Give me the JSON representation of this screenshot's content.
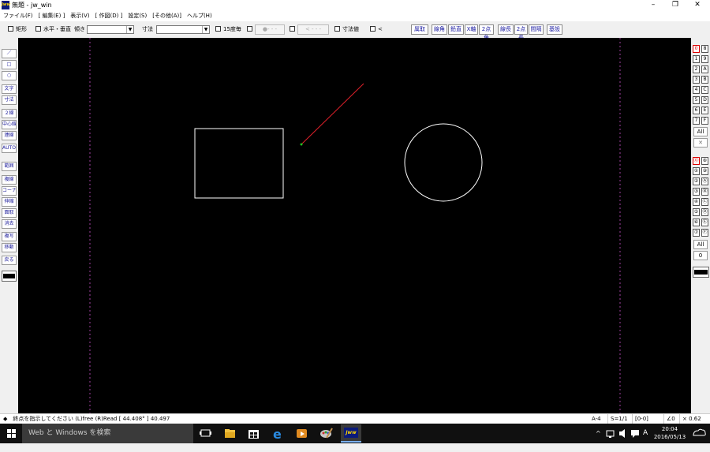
{
  "window": {
    "title": "無題 - jw_win",
    "app_icon_text": "Jww",
    "minimize_glyph": "–",
    "maximize_glyph": "❐",
    "close_glyph": "✕"
  },
  "menu": [
    "ファイル(F)",
    "[ 編集(E) ]",
    "表示(V)",
    "[ 作図(D) ]",
    "設定(S)",
    "[その他(A)]",
    "ヘルプ(H)"
  ],
  "toolbar": {
    "rect_label": "矩形",
    "hv_label": "水平・垂直",
    "slope_label": "傾き",
    "slope_value": "",
    "dim_label": "寸法",
    "dim_value": "",
    "deg15_label": "15度毎",
    "grey1_label": "●- - -",
    "grey2_label": "< - - -",
    "dimval_label": "寸法値",
    "lt_label": "<",
    "buttons": [
      "属取",
      "線角",
      "鉛直",
      "X軸",
      "2点角",
      "線長",
      "2点長",
      "間隔",
      "基設"
    ]
  },
  "left_tools": [
    "／",
    "□",
    "○",
    "文字",
    "寸法",
    "２線",
    "中心線",
    "連線",
    "AUTO",
    "範囲",
    "複線",
    "コーナー",
    "伸縮",
    "面取",
    "消去",
    "複写",
    "移動",
    "戻る"
  ],
  "layer_groups": {
    "rows_left": [
      "0",
      "1",
      "2",
      "3",
      "4",
      "5",
      "6",
      "7"
    ],
    "rows_right": [
      "8",
      "9",
      "A",
      "B",
      "C",
      "D",
      "E",
      "F"
    ],
    "all_label": "All",
    "x_label": "✕",
    "layers_left": [
      "⓪",
      "①",
      "②",
      "③",
      "④",
      "⑤",
      "⑥",
      "⑦"
    ],
    "layers_right": [
      "⑧",
      "⑨",
      "Ⓐ",
      "Ⓑ",
      "Ⓒ",
      "Ⓓ",
      "Ⓔ",
      "Ⓕ"
    ],
    "all2_label": "All",
    "zero_label": "0"
  },
  "status": {
    "message": "◆　終点を指示してください (L)free (R)Read [ 44.408° ] 40.497",
    "paper": "A-4",
    "scale": "S=1/1",
    "layer": "[0-0]",
    "angle": "∠0",
    "zoom": "× 0.62"
  },
  "taskbar": {
    "search_placeholder": "Web と Windows を検索",
    "ime": "A",
    "time": "20:04",
    "date": "2016/05/13"
  },
  "colors": {
    "canvas": "#000000",
    "line_red": "#e0202a",
    "shape_white": "#ffffff",
    "guide_purple": "#a040a0",
    "point_green": "#20c020"
  }
}
